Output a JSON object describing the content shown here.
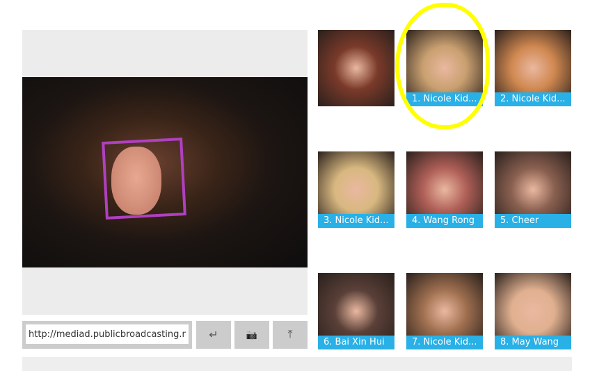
{
  "url_input": {
    "value": "http://mediad.publicbroadcasting.net"
  },
  "buttons": [
    {
      "name": "submit-url-button",
      "icon": "enter-icon",
      "glyph": "↵"
    },
    {
      "name": "camera-button",
      "icon": "camera-icon",
      "glyph": "📷"
    },
    {
      "name": "upload-button",
      "icon": "upload-icon",
      "glyph": "⤒"
    }
  ],
  "results": [
    {
      "label": "",
      "color": "#7a3a2a"
    },
    {
      "label": "1. Nicole Kid...",
      "color": "#c9a070"
    },
    {
      "label": "2. Nicole Kid...",
      "color": "#d08850"
    },
    {
      "label": "3. Nicole Kid...",
      "color": "#d8b880"
    },
    {
      "label": "4. Wang Rong",
      "color": "#b06058"
    },
    {
      "label": "5. Cheer",
      "color": "#8a6050"
    },
    {
      "label": "6. Bai Xin Hui",
      "color": "#5a4038"
    },
    {
      "label": "7. Nicole Kid...",
      "color": "#a07050"
    },
    {
      "label": "8. May Wang",
      "color": "#e0b090"
    }
  ],
  "colors": {
    "label_bg": "#29b0e6",
    "face_box": "#b040c0",
    "highlight": "#ffff00"
  }
}
